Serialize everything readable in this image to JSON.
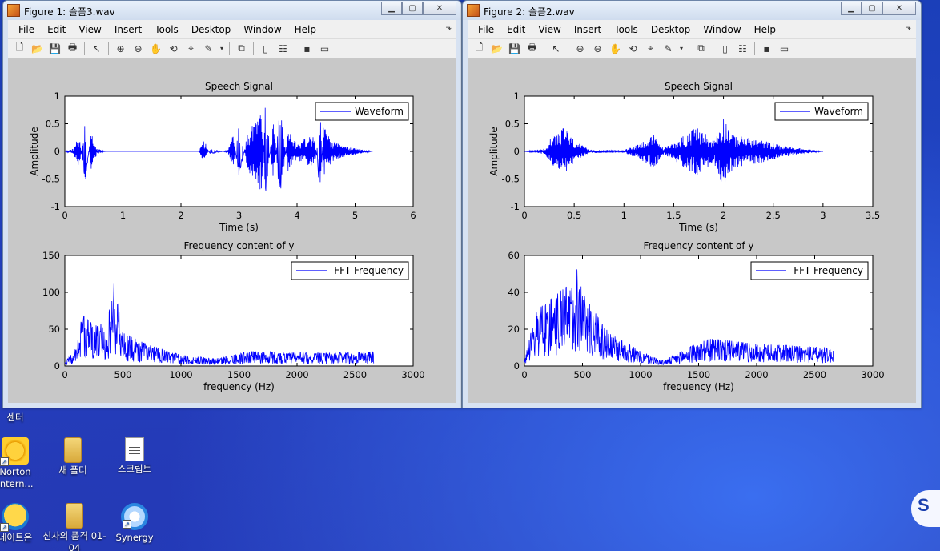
{
  "figures": [
    {
      "title": "Figure 1: 슬픔3.wav",
      "menu": [
        "File",
        "Edit",
        "View",
        "Insert",
        "Tools",
        "Desktop",
        "Window",
        "Help"
      ],
      "top": {
        "title": "Speech Signal",
        "xlabel": "Time (s)",
        "ylabel": "Amplitude",
        "legend": "Waveform",
        "xticks": [
          "0",
          "1",
          "2",
          "3",
          "4",
          "5",
          "6"
        ],
        "yticks": [
          "1",
          "0.5",
          "0",
          "-0.5",
          "-1"
        ]
      },
      "bottom": {
        "title": "Frequency content of y",
        "xlabel": "frequency (Hz)",
        "legend": "FFT Frequency",
        "xticks": [
          "0",
          "500",
          "1000",
          "1500",
          "2000",
          "2500",
          "3000"
        ],
        "yticks": [
          "150",
          "100",
          "50",
          "0"
        ]
      }
    },
    {
      "title": "Figure 2: 슬픔2.wav",
      "menu": [
        "File",
        "Edit",
        "View",
        "Insert",
        "Tools",
        "Desktop",
        "Window",
        "Help"
      ],
      "top": {
        "title": "Speech Signal",
        "xlabel": "Time (s)",
        "ylabel": "Amplitude",
        "legend": "Waveform",
        "xticks": [
          "0",
          "0.5",
          "1",
          "1.5",
          "2",
          "2.5",
          "3",
          "3.5"
        ],
        "yticks": [
          "1",
          "0.5",
          "0",
          "-0.5",
          "-1"
        ]
      },
      "bottom": {
        "title": "Frequency content of y",
        "xlabel": "frequency (Hz)",
        "legend": "FFT Frequency",
        "xticks": [
          "0",
          "500",
          "1000",
          "1500",
          "2000",
          "2500",
          "3000"
        ],
        "yticks": [
          "60",
          "40",
          "20",
          "0"
        ]
      }
    }
  ],
  "desktop": {
    "icons": [
      {
        "label": "센터",
        "icon": "app-icon"
      },
      {
        "label": "Norton Intern...",
        "icon": "norton-icon"
      },
      {
        "label": "새 폴더",
        "icon": "folder-icon"
      },
      {
        "label": "스크립트",
        "icon": "document-icon"
      },
      {
        "label": "네이트온",
        "icon": "nateon-icon"
      },
      {
        "label": "신사의 품격 01-04",
        "icon": "folder-icon"
      },
      {
        "label": "Synergy",
        "icon": "synergy-icon"
      }
    ],
    "watermark": "S"
  },
  "chart_data": [
    {
      "figure": 1,
      "type": "line",
      "title": "Speech Signal",
      "xlabel": "Time (s)",
      "ylabel": "Amplitude",
      "xlim": [
        0,
        6
      ],
      "ylim": [
        -1,
        1
      ],
      "series": [
        {
          "name": "Waveform",
          "color": "#0000ff",
          "envelope": [
            [
              0,
              0
            ],
            [
              0.15,
              0.05
            ],
            [
              0.25,
              0.3
            ],
            [
              0.35,
              -0.6
            ],
            [
              0.45,
              0.35
            ],
            [
              0.55,
              0.05
            ],
            [
              0.7,
              0
            ],
            [
              2.3,
              0
            ],
            [
              2.4,
              0.2
            ],
            [
              2.5,
              -0.05
            ],
            [
              2.8,
              0.02
            ],
            [
              2.9,
              0.3
            ],
            [
              3.0,
              -0.5
            ],
            [
              3.15,
              0.35
            ],
            [
              3.4,
              0.75
            ],
            [
              3.45,
              -0.95
            ],
            [
              3.6,
              0.7
            ],
            [
              3.7,
              -0.95
            ],
            [
              3.85,
              0.4
            ],
            [
              4.0,
              0.15
            ],
            [
              4.3,
              0.35
            ],
            [
              4.4,
              -0.85
            ],
            [
              4.45,
              0.5
            ],
            [
              4.6,
              0.2
            ],
            [
              4.8,
              0.1
            ],
            [
              5.3,
              0
            ]
          ]
        }
      ]
    },
    {
      "figure": 1,
      "type": "line",
      "title": "Frequency content of y",
      "xlabel": "frequency (Hz)",
      "xlim": [
        0,
        3000
      ],
      "ylim": [
        0,
        150
      ],
      "series": [
        {
          "name": "FFT Frequency",
          "color": "#0000ff",
          "envelope": [
            [
              0,
              5
            ],
            [
              100,
              25
            ],
            [
              150,
              70
            ],
            [
              250,
              55
            ],
            [
              300,
              65
            ],
            [
              350,
              40
            ],
            [
              420,
              115
            ],
            [
              500,
              45
            ],
            [
              700,
              30
            ],
            [
              1000,
              15
            ],
            [
              1300,
              10
            ],
            [
              1600,
              20
            ],
            [
              2000,
              18
            ],
            [
              2500,
              18
            ],
            [
              2660,
              20
            ]
          ]
        }
      ]
    },
    {
      "figure": 2,
      "type": "line",
      "title": "Speech Signal",
      "xlabel": "Time (s)",
      "ylabel": "Amplitude",
      "xlim": [
        0,
        3.5
      ],
      "ylim": [
        -1,
        1
      ],
      "series": [
        {
          "name": "Waveform",
          "color": "#0000ff",
          "envelope": [
            [
              0,
              0
            ],
            [
              0.2,
              0.05
            ],
            [
              0.3,
              0.35
            ],
            [
              0.4,
              0.45
            ],
            [
              0.5,
              0.2
            ],
            [
              0.65,
              0.03
            ],
            [
              1.0,
              0.02
            ],
            [
              1.1,
              0.1
            ],
            [
              1.3,
              0.3
            ],
            [
              1.4,
              0.05
            ],
            [
              1.6,
              0.3
            ],
            [
              1.75,
              0.45
            ],
            [
              1.9,
              0.2
            ],
            [
              2.0,
              0.65
            ],
            [
              2.1,
              0.3
            ],
            [
              2.4,
              0.2
            ],
            [
              2.6,
              0.1
            ],
            [
              3.0,
              0
            ]
          ]
        }
      ]
    },
    {
      "figure": 2,
      "type": "line",
      "title": "Frequency content of y",
      "xlabel": "frequency (Hz)",
      "xlim": [
        0,
        3000
      ],
      "ylim": [
        0,
        60
      ],
      "series": [
        {
          "name": "FFT Frequency",
          "color": "#0000ff",
          "envelope": [
            [
              0,
              3
            ],
            [
              100,
              30
            ],
            [
              200,
              35
            ],
            [
              300,
              40
            ],
            [
              400,
              45
            ],
            [
              450,
              53
            ],
            [
              500,
              40
            ],
            [
              700,
              20
            ],
            [
              1000,
              8
            ],
            [
              1200,
              3
            ],
            [
              1400,
              10
            ],
            [
              1600,
              15
            ],
            [
              2000,
              12
            ],
            [
              2660,
              10
            ]
          ]
        }
      ]
    }
  ]
}
